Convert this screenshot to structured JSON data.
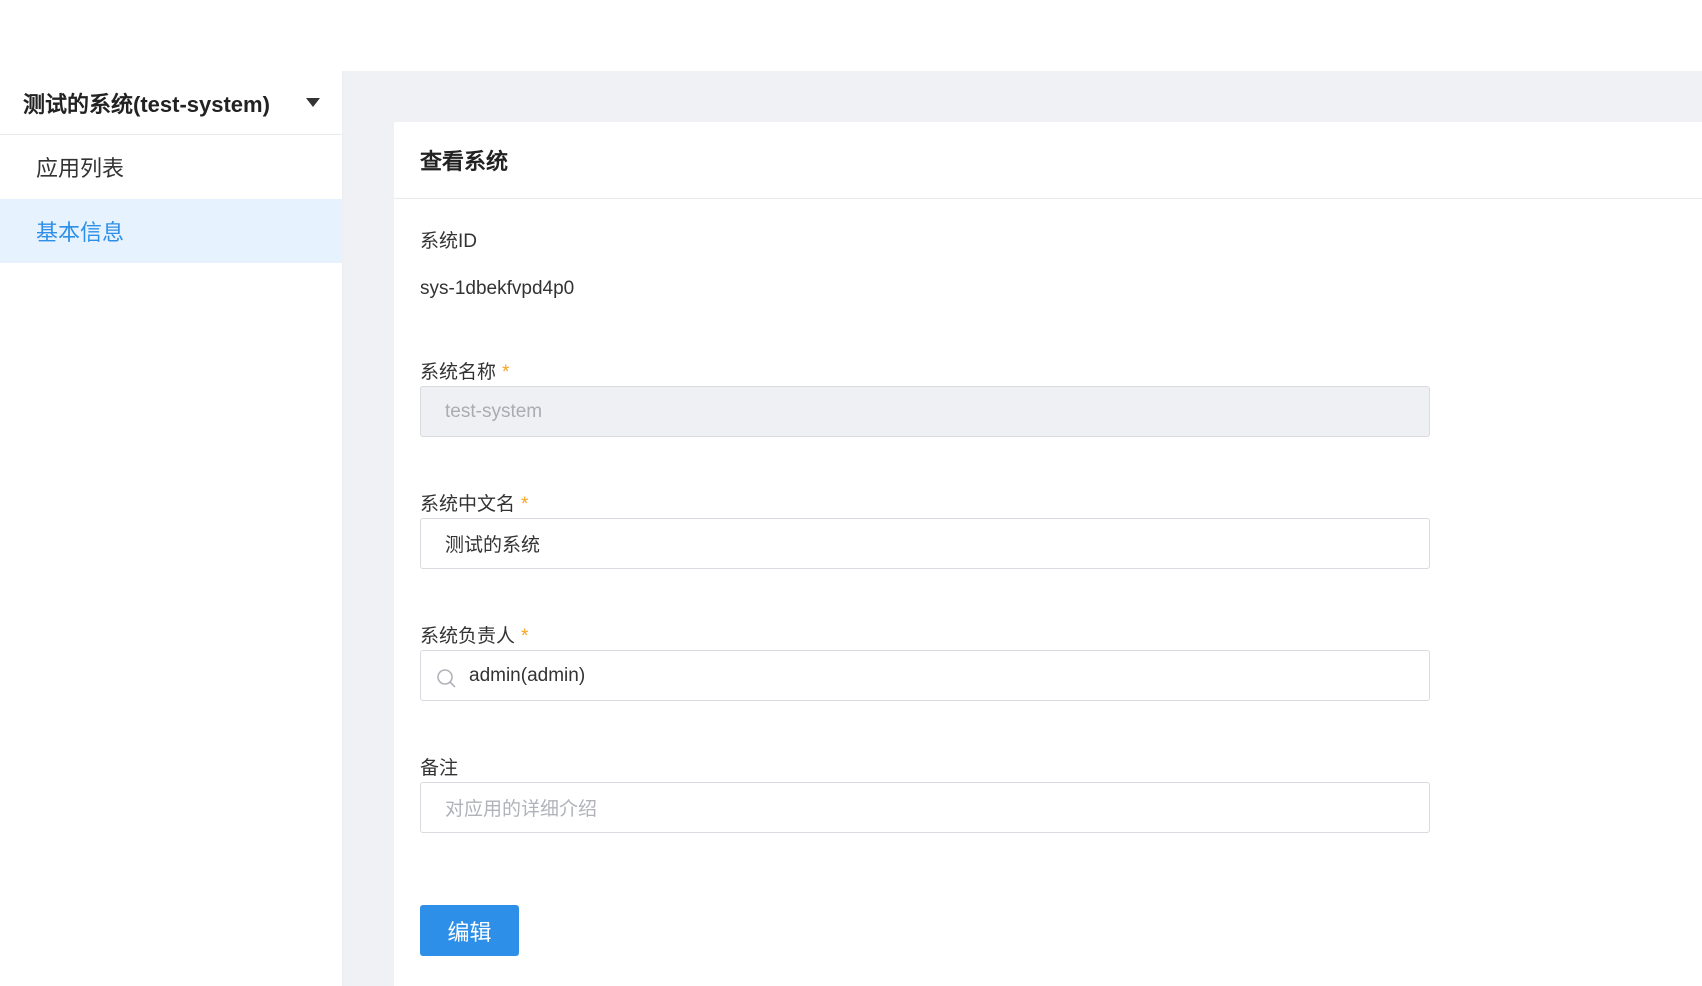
{
  "sidebar": {
    "system_name": "测试的系统(test-system)",
    "items": [
      {
        "label": "应用列表",
        "active": false
      },
      {
        "label": "基本信息",
        "active": true
      }
    ]
  },
  "page": {
    "title": "查看系统"
  },
  "form": {
    "system_id": {
      "label": "系统ID",
      "value": "sys-1dbekfvpd4p0"
    },
    "system_name": {
      "label": "系统名称",
      "required_mark": "*",
      "value": "test-system"
    },
    "system_cn_name": {
      "label": "系统中文名",
      "required_mark": "*",
      "value": "测试的系统"
    },
    "owner": {
      "label": "系统负责人",
      "required_mark": "*",
      "value": "admin(admin)"
    },
    "remark": {
      "label": "备注",
      "placeholder": "对应用的详细介绍",
      "value": ""
    },
    "edit_label": "编辑"
  },
  "colors": {
    "accent": "#2e8fe8",
    "active_bg": "#e6f2fd",
    "required": "#f5a623",
    "content_bg": "#f0f1f4"
  }
}
